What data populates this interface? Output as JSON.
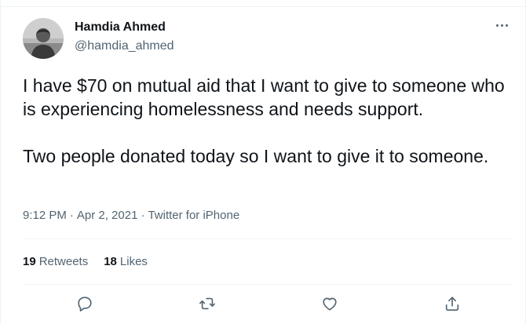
{
  "author": {
    "display_name": "Hamdia Ahmed",
    "handle": "@hamdia_ahmed",
    "avatar": "profile-photo"
  },
  "more_icon": "more-horizontal-icon",
  "tweet": {
    "paragraphs": [
      "I have $70 on mutual aid that I want to give to someone who is experiencing homelessness and needs support.",
      "Two people donated today so I want to give it to someone."
    ],
    "time": "9:12 PM",
    "date": "Apr 2, 2021",
    "source": "Twitter for iPhone",
    "separator": "·"
  },
  "stats": {
    "retweets_count": "19",
    "retweets_label": "Retweets",
    "likes_count": "18",
    "likes_label": "Likes"
  },
  "actions": [
    "reply-icon",
    "retweet-icon",
    "like-icon",
    "share-icon"
  ],
  "colors": {
    "text_primary": "#0f1419",
    "text_secondary": "#536471",
    "divider": "#eff3f4"
  }
}
